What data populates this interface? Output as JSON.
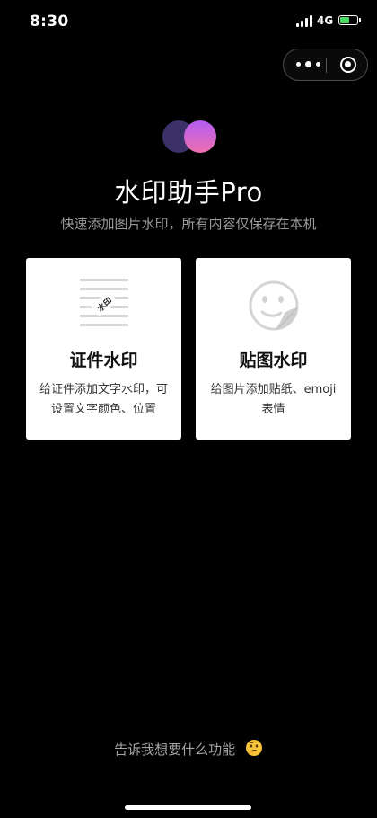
{
  "status_bar": {
    "time": "8:30",
    "network": "4G"
  },
  "capsule": {
    "more_icon": "more-dots-icon",
    "close_icon": "target-close-icon"
  },
  "app": {
    "title": "水印助手Pro",
    "subtitle": "快速添加图片水印，所有内容仅保存在本机"
  },
  "cards": [
    {
      "title": "证件水印",
      "desc_line1": "给证件添加文字水印，可",
      "desc_line2": "设置文字颜色、位置",
      "icon": "document-watermark-icon",
      "icon_stamp_text": "水印"
    },
    {
      "title": "贴图水印",
      "desc_line1": "给图片添加贴纸、emoji",
      "desc_line2": "表情",
      "icon": "smiley-sticker-icon"
    }
  ],
  "footer": {
    "feedback_label": "告诉我想要什么功能",
    "feedback_icon": "thinking-face-icon"
  },
  "colors": {
    "background": "#000000",
    "card_background": "#ffffff",
    "logo_dark": "#3b3168",
    "logo_gradient_top": "#b35cf2",
    "logo_gradient_bottom": "#ef6fb1",
    "battery_fill": "#4cd964"
  }
}
